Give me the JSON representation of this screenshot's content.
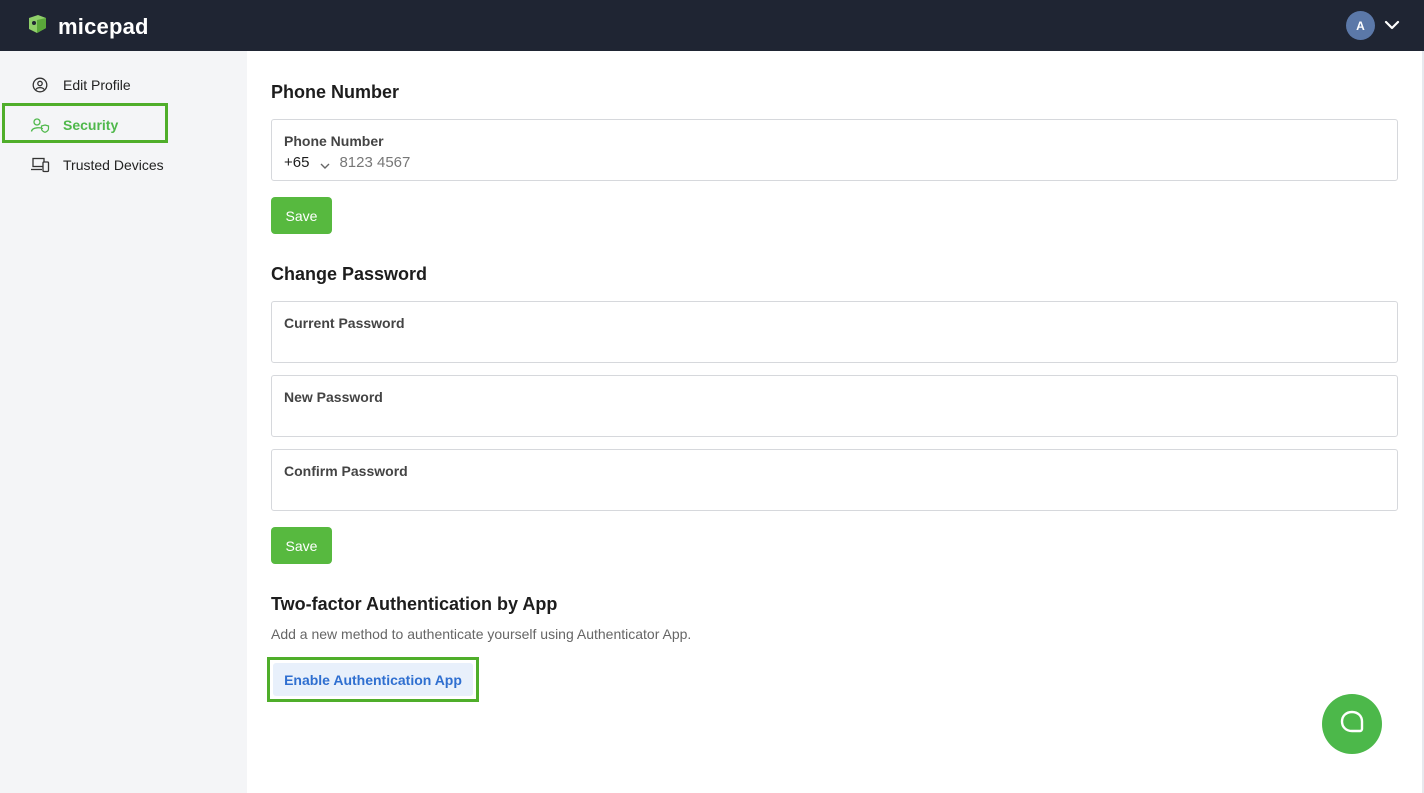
{
  "app": {
    "brand": "micepad",
    "avatar_initial": "A"
  },
  "colors": {
    "topbar": "#1f2533",
    "accent_green": "#57b93f",
    "link_blue": "#2f6fd0",
    "sidebar_bg": "#f4f5f7"
  },
  "sidebar": {
    "items": [
      {
        "label": "Edit Profile",
        "icon": "user-circle-icon",
        "active": false
      },
      {
        "label": "Security",
        "icon": "user-shield-icon",
        "active": true
      },
      {
        "label": "Trusted Devices",
        "icon": "devices-icon",
        "active": false
      }
    ]
  },
  "phone": {
    "title": "Phone Number",
    "field_label": "Phone Number",
    "country_code": "+65",
    "placeholder": "8123 4567",
    "save_label": "Save"
  },
  "password": {
    "title": "Change Password",
    "current_label": "Current Password",
    "new_label": "New Password",
    "confirm_label": "Confirm Password",
    "save_label": "Save"
  },
  "two_factor": {
    "title": "Two-factor Authentication by App",
    "description": "Add a new method to authenticate yourself using Authenticator App.",
    "button_label": "Enable Authentication App"
  }
}
